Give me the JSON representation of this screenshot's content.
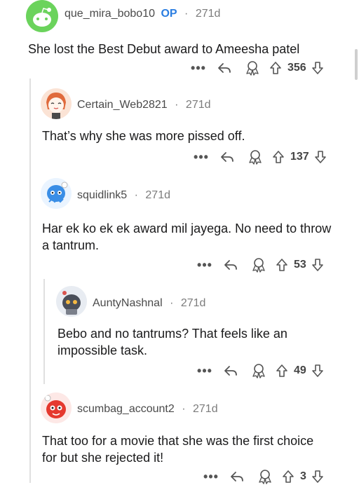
{
  "comments": [
    {
      "username": "que_mira_bobo10",
      "op_badge": "OP",
      "age": "271d",
      "text": "She lost the Best Debut award to Ameesha patel",
      "score": "356",
      "avatar_color": "#6bd35c"
    },
    {
      "username": "Certain_Web2821",
      "age": "271d",
      "text": "That’s why she was more pissed off.",
      "score": "137"
    },
    {
      "username": "squidlink5",
      "age": "271d",
      "text": "Har ek ko ek ek award mil jayega. No need to throw a tantrum.",
      "score": "53"
    },
    {
      "username": "AuntyNashnal",
      "age": "271d",
      "text": "Bebo and no tantrums? That feels like an impossible task.",
      "score": "49"
    },
    {
      "username": "scumbag_account2",
      "age": "271d",
      "text": "That too for a movie that she was the first choice for but she rejected it!",
      "score": "3"
    }
  ],
  "icons": {
    "more": "more-options-icon",
    "reply": "reply-icon",
    "award": "award-icon",
    "upvote": "upvote-icon",
    "downvote": "downvote-icon"
  },
  "actions": {
    "more_label": "•••"
  },
  "separator": "·"
}
